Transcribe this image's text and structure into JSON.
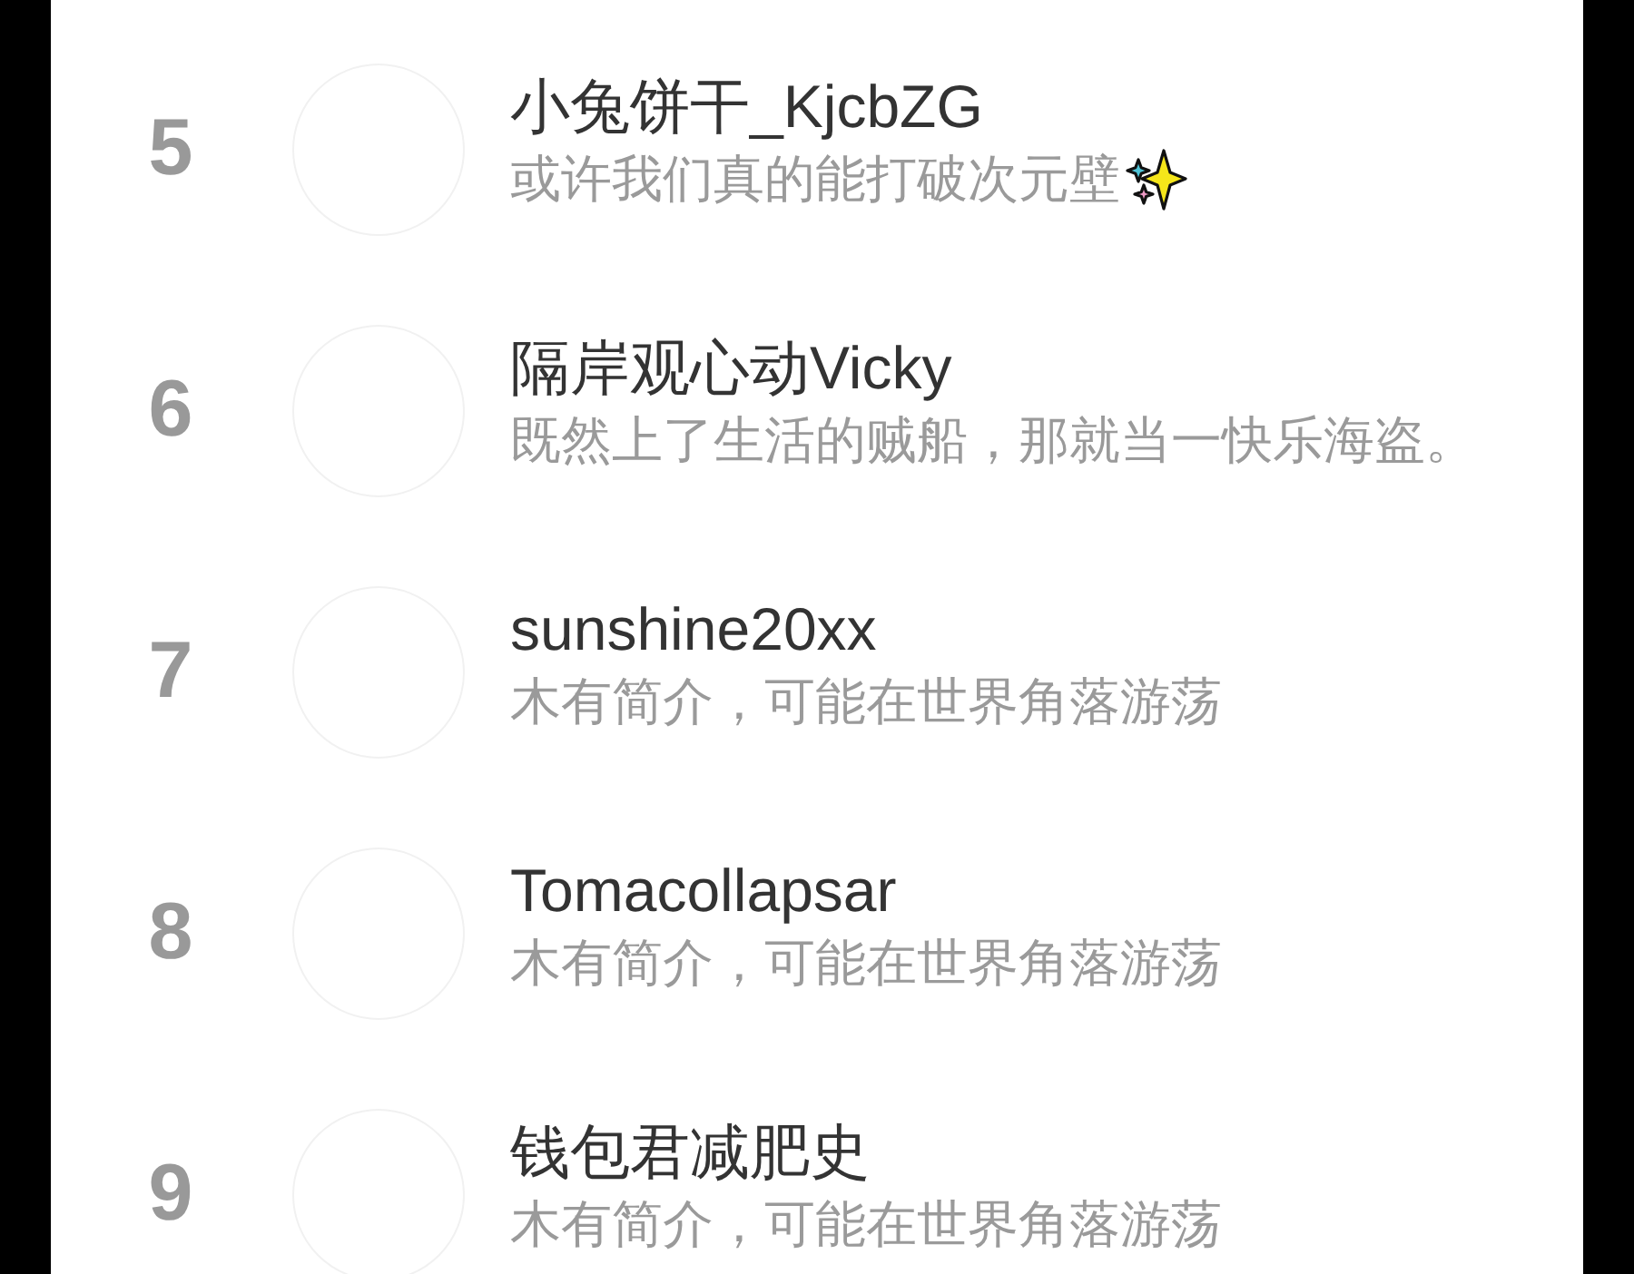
{
  "rankings": [
    {
      "rank": "5",
      "name": "小兔饼干_KjcbZG",
      "bio": "或许我们真的能打破次元壁",
      "trailing_icon": true
    },
    {
      "rank": "6",
      "name": "隔岸观心动Vicky",
      "bio": "既然上了生活的贼船，那就当一快乐海盗。"
    },
    {
      "rank": "7",
      "name": "sunshine20xx",
      "bio": "木有简介，可能在世界角落游荡"
    },
    {
      "rank": "8",
      "name": "Tomacollapsar",
      "bio": "木有简介，可能在世界角落游荡"
    },
    {
      "rank": "9",
      "name": "钱包君减肥史",
      "bio": "木有简介，可能在世界角落游荡"
    }
  ]
}
